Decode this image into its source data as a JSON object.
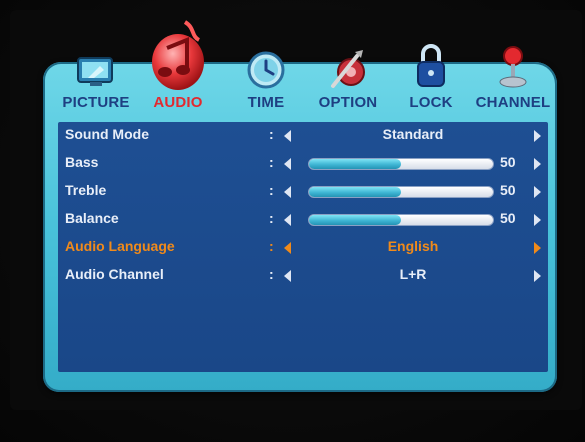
{
  "tabs": [
    {
      "label": "PICTURE",
      "icon": "picture-icon"
    },
    {
      "label": "AUDIO",
      "icon": "audio-icon",
      "active": true
    },
    {
      "label": "TIME",
      "icon": "clock-icon"
    },
    {
      "label": "OPTION",
      "icon": "option-icon"
    },
    {
      "label": "LOCK",
      "icon": "lock-icon"
    },
    {
      "label": "CHANNEL",
      "icon": "channel-icon"
    }
  ],
  "rows": [
    {
      "name": "Sound Mode",
      "colon": ":",
      "value": "Standard"
    },
    {
      "name": "Bass",
      "colon": ":",
      "level": 50,
      "level_text": "50"
    },
    {
      "name": "Treble",
      "colon": ":",
      "level": 50,
      "level_text": "50"
    },
    {
      "name": "Balance",
      "colon": ":",
      "level": 50,
      "level_text": "50"
    },
    {
      "name": "Audio Language",
      "colon": ":",
      "value": "English",
      "selected": true
    },
    {
      "name": "Audio Channel",
      "colon": ":",
      "value": "L+R"
    }
  ],
  "colors": {
    "frame": "#49c2da",
    "panel": "#1e4f93",
    "tab_label": "#1e3f82",
    "tab_active": "#e3292f",
    "selected_text": "#f08a1a"
  }
}
